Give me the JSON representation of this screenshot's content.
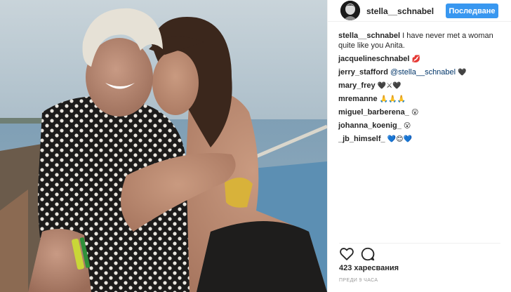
{
  "post": {
    "username": "stella__schnabel",
    "follow_label": "Последване",
    "caption_user": "stella__schnabel",
    "caption_text": "I have never met a woman quite like you Anita.",
    "likes": "423 харесвания",
    "time": "ПРЕДИ 9 ЧАСА"
  },
  "comments": [
    {
      "user": "jacquelineschnabel",
      "text": "",
      "emoji": "💋"
    },
    {
      "user": "jerry_stafford",
      "mention": "@stella__schnabel",
      "text": "",
      "emoji": "🖤"
    },
    {
      "user": "mary_frey",
      "text": "",
      "emoji": "🖤⚔🖤"
    },
    {
      "user": "mremanne",
      "text": "",
      "emoji": "🙏🙏🙏"
    },
    {
      "user": "miguel_barberena_",
      "text": "",
      "emoji": "😮"
    },
    {
      "user": "johanna_koenig_",
      "text": "",
      "emoji": "😮"
    },
    {
      "user": "_jb_himself_",
      "text": "",
      "emoji": "💙😊💙"
    }
  ],
  "icons": {
    "like": "heart-icon",
    "comment": "comment-bubble-icon"
  },
  "colors": {
    "follow_button": "#3897f0",
    "mention": "#003569",
    "timestamp": "#999999"
  }
}
